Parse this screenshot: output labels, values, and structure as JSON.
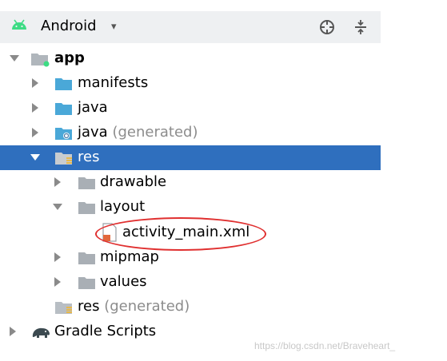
{
  "header": {
    "view_label": "Android",
    "caret": "▾"
  },
  "tree": {
    "app": "app",
    "manifests": "manifests",
    "java": "java",
    "java_generated": "java",
    "java_generated_suffix": "(generated)",
    "res": "res",
    "drawable": "drawable",
    "layout": "layout",
    "activity_main": "activity_main.xml",
    "mipmap": "mipmap",
    "values": "values",
    "res_generated": "res",
    "res_generated_suffix": "(generated)",
    "gradle_scripts": "Gradle Scripts"
  },
  "colors": {
    "selection": "#2f6fbe",
    "annotation": "#e03030",
    "folder": "#4aa8d8"
  },
  "watermark": "https://blog.csdn.net/Braveheart_"
}
